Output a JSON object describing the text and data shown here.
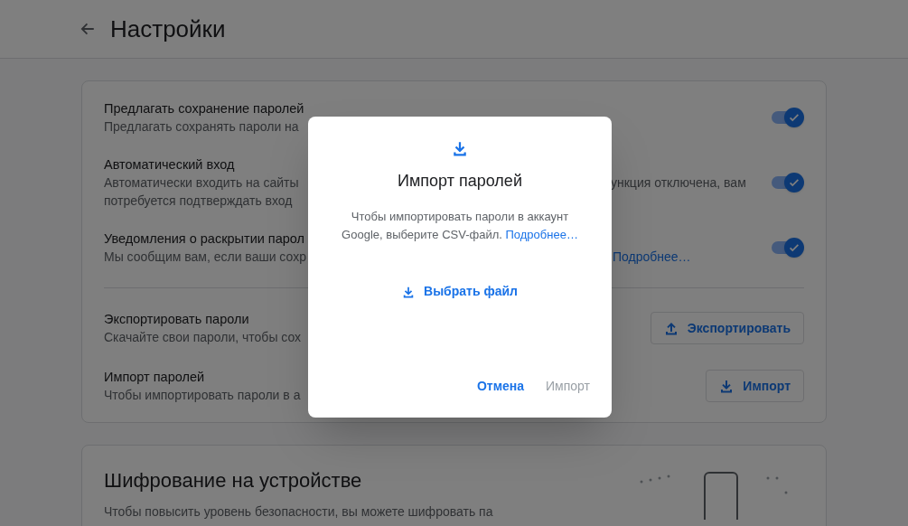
{
  "header": {
    "title": "Настройки"
  },
  "settings": [
    {
      "kind": "toggle",
      "title": "Предлагать сохранение паролей",
      "description": [
        "Предлагать сохранять пароли на"
      ],
      "on": true
    },
    {
      "kind": "toggle",
      "title": "Автоматический вход",
      "description": [
        "Автоматически входить на сайты",
        "потребуется подтверждать вход"
      ],
      "description_right": "ункция отключена, вам",
      "on": true
    },
    {
      "kind": "toggle",
      "title": "Уведомления о раскрытии парол",
      "description": [
        "Мы сообщим вам, если ваши сохр"
      ],
      "link_right": "Подробнее…",
      "on": true
    },
    {
      "kind": "divider"
    },
    {
      "kind": "export",
      "title": "Экспортировать пароли",
      "description": [
        "Скачайте свои пароли, чтобы сох"
      ],
      "button": "Экспортировать"
    },
    {
      "kind": "import",
      "title": "Импорт паролей",
      "description": [
        "Чтобы импортировать пароли в а"
      ],
      "button": "Импорт"
    }
  ],
  "encryption": {
    "title": "Шифрование на устройстве",
    "description": "Чтобы повысить уровень безопасности, вы можете шифровать па"
  },
  "dialog": {
    "title": "Импорт паролей",
    "text": "Чтобы импортировать пароли в аккаунт Google, выберите CSV-файл.",
    "link": "Подробнее…",
    "choose_file": "Выбрать файл",
    "buttons": [
      {
        "label": "Отмена",
        "disabled": false
      },
      {
        "label": "Импорт",
        "disabled": true
      }
    ]
  }
}
